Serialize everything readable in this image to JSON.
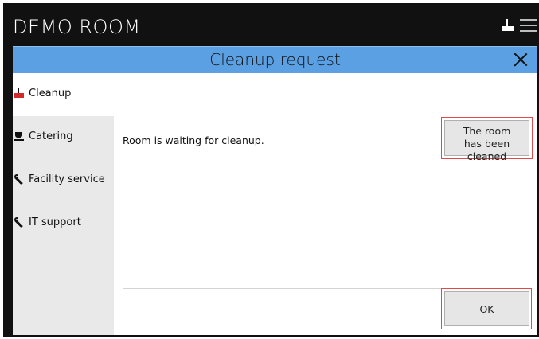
{
  "room": {
    "title": "DEMO ROOM"
  },
  "topbar": {
    "icons": [
      "cleanup-icon",
      "menu-icon"
    ]
  },
  "dialog": {
    "title": "Cleanup request",
    "close_icon": "close-icon"
  },
  "sidebar": {
    "items": [
      {
        "label": "Cleanup",
        "icon": "cleanup-icon",
        "active": true
      },
      {
        "label": "Catering",
        "icon": "catering-icon",
        "active": false
      },
      {
        "label": "Facility service",
        "icon": "wrench-icon",
        "active": false
      },
      {
        "label": "IT support",
        "icon": "wrench-icon",
        "active": false
      }
    ]
  },
  "content": {
    "status_text": "Room is waiting for cleanup.",
    "cleaned_button": {
      "line1": "The room",
      "line2": "has been cleaned"
    },
    "ok_button": "OK"
  },
  "colors": {
    "header_bg": "#5aa0e2",
    "topbar_bg": "#111111",
    "sidebar_bg": "#e9e9e9",
    "highlight_outline": "#e04a4a",
    "cleanup_icon_accent": "#d12a2a"
  }
}
